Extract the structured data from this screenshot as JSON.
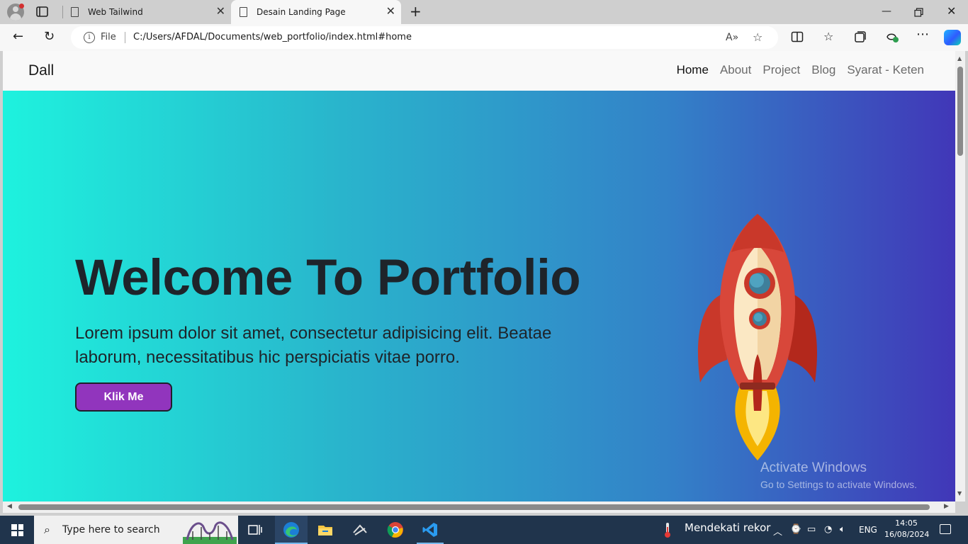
{
  "browser": {
    "tabs": [
      {
        "title": "Web Tailwind",
        "active": false
      },
      {
        "title": "Desain Landing Page",
        "active": true
      }
    ],
    "address": {
      "scheme_label": "File",
      "url": "C:/Users/AFDAL/Documents/web_portfolio/index.html#home"
    }
  },
  "site": {
    "brand": "Dall",
    "nav": [
      {
        "label": "Home",
        "active": true
      },
      {
        "label": "About",
        "active": false
      },
      {
        "label": "Project",
        "active": false
      },
      {
        "label": "Blog",
        "active": false
      },
      {
        "label": "Syarat - Keten",
        "active": false
      }
    ],
    "hero": {
      "title": "Welcome To Portfolio",
      "text": "Lorem ipsum dolor sit amet, consectetur adipisicing elit. Beatae laborum, necessitatibus hic perspiciatis vitae porro.",
      "button_label": "Klik Me",
      "gradient": [
        "#1ef2de",
        "#4137b8"
      ],
      "button_color": "#9135bd"
    }
  },
  "watermark": {
    "line1": "Activate Windows",
    "line2": "Go to Settings to activate Windows."
  },
  "taskbar": {
    "search_placeholder": "Type here to search",
    "weather": "Mendekati rekor",
    "language": "ENG",
    "time": "14:05",
    "date": "16/08/2024",
    "apps": [
      "task-view-icon",
      "edge-icon",
      "file-explorer-icon",
      "terminal-icon",
      "chrome-icon",
      "vscode-icon"
    ]
  }
}
